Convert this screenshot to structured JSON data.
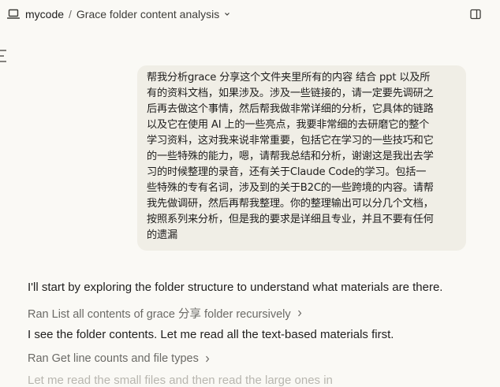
{
  "header": {
    "project": "mycode",
    "separator": "/",
    "conversation_title": "Grace folder content analysis"
  },
  "icons": {
    "app": "laptop-icon",
    "title_menu": "chevron-down-icon",
    "panel": "sidebar-toggle-icon",
    "tool_expand": "chevron-right-icon"
  },
  "user_message": {
    "text": "帮我分析grace 分享这个文件夹里所有的内容 结合 ppt 以及所\n有的资料文档，如果涉及。涉及一些链接的，请一定要先调研之\n后再去做这个事情，然后帮我做非常详细的分析，它具体的链路\n以及它在使用 AI 上的一些亮点，我要非常细的去研磨它的整个\n学习资料，这对我来说非常重要，包括它在学习的一些技巧和它\n的一些特殊的能力，嗯，请帮我总结和分析，谢谢这是我出去学\n习的时候整理的录音，还有关于Claude Code的学习。包括一\n些特殊的专有名词，涉及到的关于B2C的一些跨境的内容。请帮\n我先做调研，然后再帮我整理。你的整理输出可以分几个文档，\n按照系列来分析，但是我的要求是详细且专业，并且不要有任何\n的遗漏"
  },
  "assistant": {
    "msg1": "I'll start by exploring the folder structure to understand what materials are there.",
    "tool1": "Ran List all contents of grace 分享 folder recursively",
    "msg2": "I see the folder contents. Let me read all the text-based materials first.",
    "tool2": "Ran Get line counts and file types",
    "msg3_partial": "Let me read the small files and then read the large ones in"
  },
  "colors": {
    "background": "#faf9f5",
    "bubble": "#f0eee6",
    "text": "#1f1e1d",
    "muted": "#6b6a66"
  }
}
